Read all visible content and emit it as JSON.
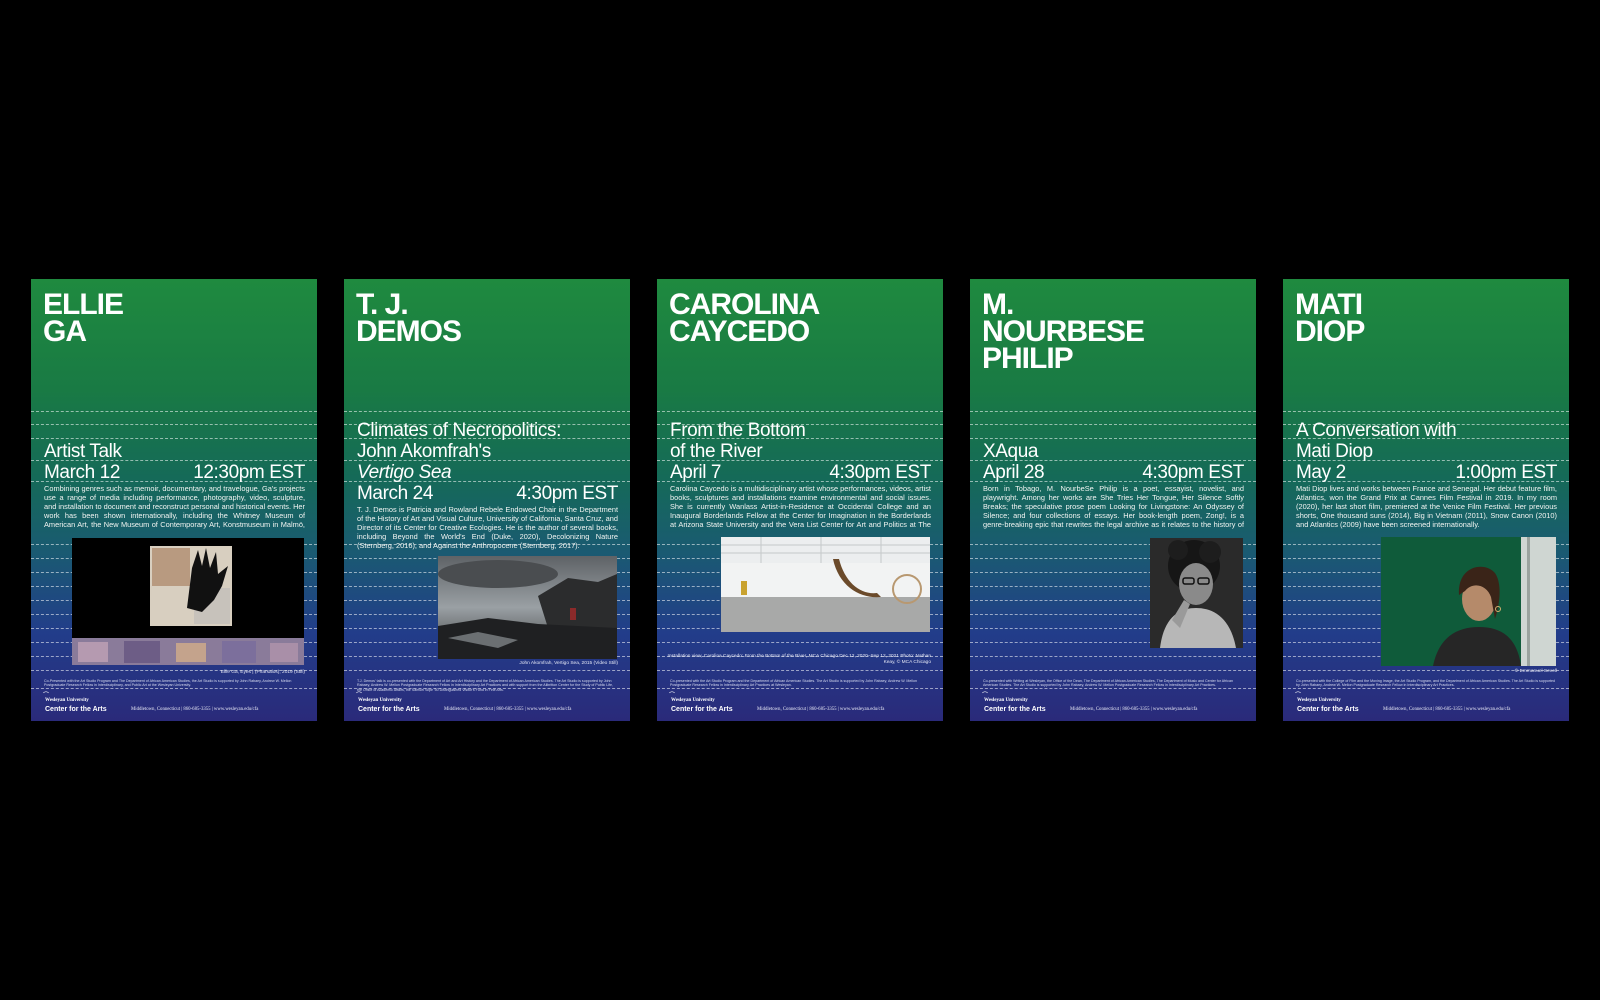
{
  "footer": {
    "university": "Wesleyan University",
    "center": "Center for the Arts",
    "address": "Middletown, Connecticut | 860-685-3355 | www.wesleyan.edu/cfa",
    "mark_icon": "wesleyan-mark-icon"
  },
  "posters": [
    {
      "name_lines": [
        "ELLIE",
        "GA"
      ],
      "title_lines": [
        "Artist Talk"
      ],
      "date": "March 12",
      "time": "12:30pm EST",
      "bio": "Combining genres such as memoir, documentary, and travelogue, Ga's projects use a range of media including performance, photography, video, sculpture, and installation to document and reconstruct personal and historical events. Her work has been shown internationally, including the Whitney Museum of American Art, the New Museum of Contemporary Art, Konstmuseum in Malmö, Sweden, the Newark Museum of Art.",
      "caption": "Ellie Ga, Eyes | (Pharsalos), 2019 (Still)",
      "credits": "Co-Presented with the Art Studio Program and The Department of African American Studies, the Art Studio is supported by John Rabaey, Andrew W. Mellon Postgraduate Research Fellow in Interdisciplinary, and Public Art at the Wesleyan University."
    },
    {
      "name_lines": [
        "T. J.",
        "DEMOS"
      ],
      "title_lines": [
        "Climates of Necropolitics:",
        "John Akomfrah's"
      ],
      "title_italic": "Vertigo Sea",
      "date": "March 24",
      "time": "4:30pm EST",
      "bio": "T. J. Demos is Patricia and Rowland Rebele Endowed Chair in the Department of the History of Art and Visual Culture, University of California, Santa Cruz, and Director of its Center for Creative Ecologies. He is the author of several books, including Beyond the World's End (Duke, 2020), Decolonizing Nature (Sternberg, 2016), and Against the Anthropocene (Sternberg, 2017).",
      "caption": "John Akomfrah, Vertigo Sea, 2015 (Video Still)",
      "credits": "T.J. Demos' talk is co-presented with the Department of Art and Art History and the Department of African American Studies. The Art Studio is supported by John Rabaey, Andrew W. Mellon Postgraduate Research Fellow in Interdisciplinary Art Practices and with support from the Allbritton Center for the Study of Public Life, the Office of Academic Affairs, the Samuel Silpe '50 Distinguished Visitor's Fund in Fine Arts."
    },
    {
      "name_lines": [
        "CAROLINA",
        "CAYCEDO"
      ],
      "title_lines": [
        "From the Bottom",
        "of the River"
      ],
      "date": "April 7",
      "time": "4:30pm EST",
      "bio": "Carolina Caycedo is a multidisciplinary artist whose performances, videos, artist books, sculptures and installations examine environmental and social issues. She is currently Wanlass Artist-in-Residence at Occidental College and an Inaugural Borderlands Fellow at the Center for Imagination in the Borderlands at Arizona State University and the Vera List Center for Art and Politics at The New School.",
      "caption": "Installation view, Carolina Caycedo: From the Bottom of the River, MCA Chicago Dec 12, 2020–Sep 12, 2021 Photo: Nathan Keay, © MCA Chicago",
      "credits": "Co-presented with the Art Studio Program and the Department of African American Studies. The Art Studio is supported by John Rabaey, Andrew W. Mellon Postgraduate Research Fellow in Interdisciplinary Art Practices at Wesleyan."
    },
    {
      "name_lines": [
        "M.",
        "NOURBESE",
        "PHILIP"
      ],
      "title_lines": [
        "XAqua"
      ],
      "date": "April 28",
      "time": "4:30pm EST",
      "bio": "Born in Tobago, M. NourbeSe Philip is a poet, essayist, novelist, and playwright. Among her works are She Tries Her Tongue, Her Silence Softly Breaks; the speculative prose poem Looking for Livingstone: An Odyssey of Silence; and four collections of essays. Her book-length poem, Zong!, is a genre-breaking epic that rewrites the legal archive as it relates to the history of the transatlantic slave trade.",
      "caption": "",
      "credits": "Co-presented with Writing at Wesleyan, the Office of the Dean, The Department of African American Studies, The Department of Music and Center for African American Studies. The Art Studio is supported by John Rabaey, Andrew W. Mellon Postgraduate Research Fellow in Interdisciplinary Art Practices."
    },
    {
      "name_lines": [
        "MATI",
        "DIOP"
      ],
      "title_lines": [
        "A Conversation with",
        "Mati Diop"
      ],
      "date": "May 2",
      "time": "1:00pm EST",
      "bio": "Mati Diop lives and works between France and Senegal. Her debut feature film, Atlantics, won the Grand Prix at Cannes Film Festival in 2019. In my room (2020), her last short film, premiered at the Venice Film Festival. Her previous shorts, One thousand suns (2014), Big in Vietnam (2011), Snow Canon (2010) and Atlantics (2009) have been screened internationally.",
      "caption": "© Emmanuel Sevell",
      "credits": "Co-presented with the College of Film and the Moving Image, the Art Studio Program, and the Department of African American Studies. The Art Studio is supported by John Rabaey, Andrew W. Mellon Postgraduate Research Fellow in Interdisciplinary Art Practices."
    }
  ]
}
